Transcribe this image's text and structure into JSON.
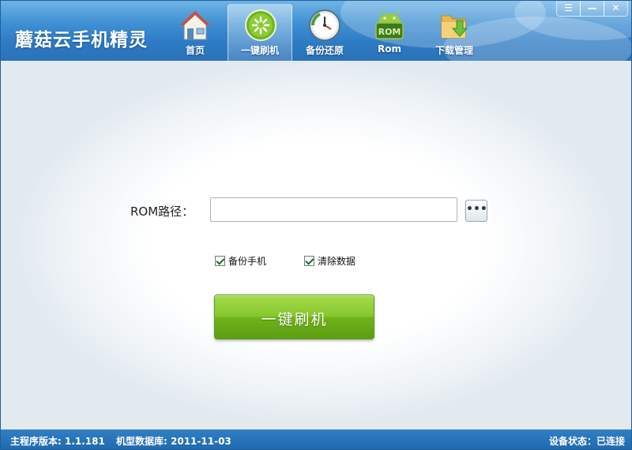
{
  "app": {
    "title": "蘑菇云手机精灵"
  },
  "nav": {
    "items": [
      {
        "label": "首页",
        "icon": "house-icon"
      },
      {
        "label": "一键刷机",
        "icon": "flash-icon",
        "active": true
      },
      {
        "label": "备份还原",
        "icon": "clock-icon"
      },
      {
        "label": "Rom",
        "icon": "android-rom-icon"
      },
      {
        "label": "下载管理",
        "icon": "folder-download-icon"
      }
    ]
  },
  "window_controls": {
    "menu": "☰",
    "minimize": "—",
    "close": "✕"
  },
  "form": {
    "rom_label": "ROM路径：",
    "rom_value": "",
    "browse_label": "•••",
    "backup_label": "备份手机",
    "backup_checked": true,
    "clear_label": "清除数据",
    "clear_checked": true,
    "flash_button": "一键刷机"
  },
  "status": {
    "version": "主程序版本: 1.1.181",
    "db": "机型数据库: 2011-11-03",
    "device": "设备状态：已连接"
  },
  "colors": {
    "accent": "#2d7bc4",
    "flash_green": "#7fc12a",
    "status_bar": "#1f68ad"
  }
}
